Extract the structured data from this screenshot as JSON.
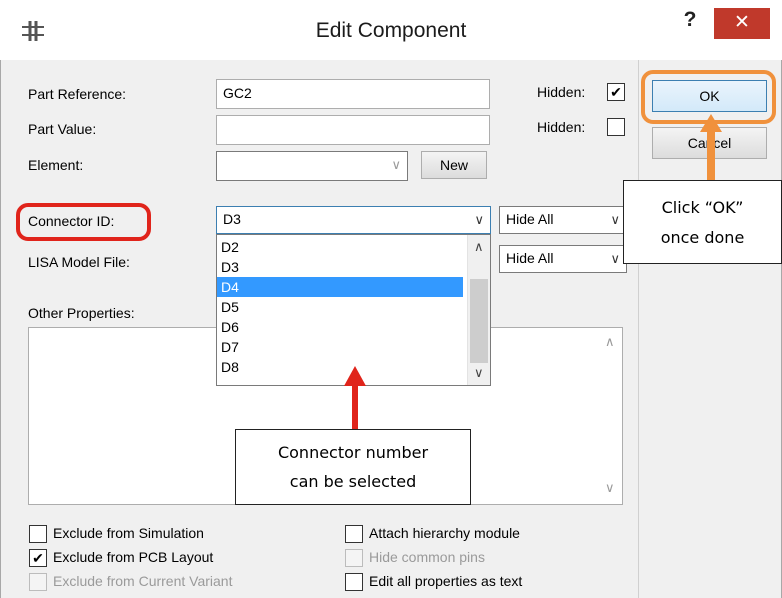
{
  "window": {
    "title": "Edit Component",
    "help_glyph": "?",
    "close_glyph": "✕"
  },
  "fields": {
    "part_reference": {
      "label": "Part Reference:",
      "value": "GC2",
      "hidden_label": "Hidden:",
      "hidden_checked": true
    },
    "part_value": {
      "label": "Part Value:",
      "value": "",
      "hidden_label": "Hidden:",
      "hidden_checked": false
    },
    "element": {
      "label": "Element:",
      "value": "",
      "new_button": "New"
    },
    "connector_id": {
      "label": "Connector ID:",
      "value": "D3",
      "visibility": "Hide All"
    },
    "lisa_model": {
      "label": "LISA Model File:",
      "visibility": "Hide All"
    },
    "other_properties": {
      "label": "Other Properties:"
    }
  },
  "dropdown": {
    "items": [
      "D2",
      "D3",
      "D4",
      "D5",
      "D6",
      "D7",
      "D8"
    ],
    "selected": "D4"
  },
  "buttons": {
    "ok": "OK",
    "cancel": "Cancel"
  },
  "checkboxes": [
    {
      "label": "Exclude from Simulation",
      "checked": false,
      "enabled": true
    },
    {
      "label": "Exclude from PCB Layout",
      "checked": true,
      "enabled": true
    },
    {
      "label": "Exclude from Current Variant",
      "checked": false,
      "enabled": false
    },
    {
      "label": "Attach hierarchy module",
      "checked": false,
      "enabled": true
    },
    {
      "label": "Hide common pins",
      "checked": false,
      "enabled": false
    },
    {
      "label": "Edit all properties as text",
      "checked": false,
      "enabled": true
    }
  ],
  "annotations": {
    "ok_line1": "Click “OK”",
    "ok_line2": "once done",
    "connector_line1": "Connector number",
    "connector_line2": "can be selected",
    "highlight_color": "#e0241b",
    "ok_highlight_color": "#f0913c"
  },
  "icons": {
    "app": "component-symbol-icon",
    "check": "✔",
    "dropdown": "chevron-down-icon"
  }
}
